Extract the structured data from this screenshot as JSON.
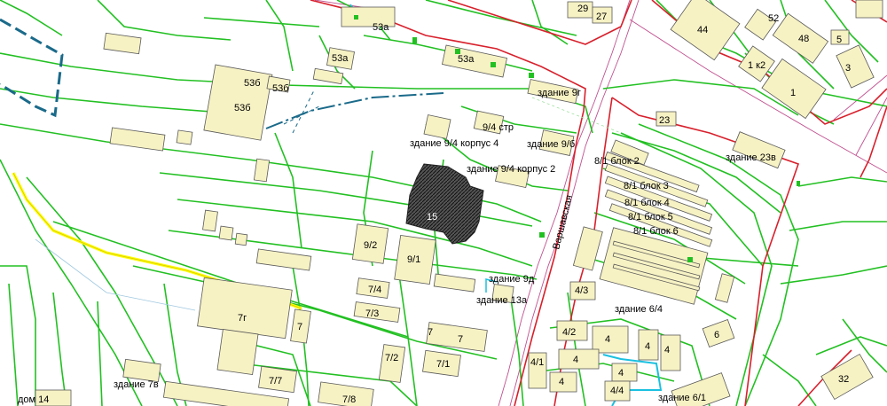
{
  "colors": {
    "parcel": "#22c022",
    "red_line": "#d8202c",
    "road_axis": "#c0508f",
    "building_fill": "#f7f2c4",
    "highlight": "#ffff00",
    "water": "#1a6a8a",
    "target": "#333333"
  },
  "street_label": "Варшавская",
  "labels": {
    "b53a_top": "53а",
    "b29": "29",
    "b27": "27",
    "b44": "44",
    "b52": "52",
    "b48": "48",
    "b5": "5",
    "b1k2": "1 к2",
    "b3": "3",
    "b1": "1",
    "b53b_a": "53б",
    "b53b_b": "53б",
    "b53b_c": "53б",
    "b53a_c": "53а",
    "b53a_d": "53а",
    "zd9g": "здание 9г",
    "b94str": "9/4 стр",
    "zd94k4": "здание 9/4 корпус 4",
    "zd9b": "здание 9/б",
    "zd94k2": "здание 9/4 корпус 2",
    "b23": "23",
    "b81b2": "8/1 блок 2",
    "zd23v": "здание 23в",
    "b81b3": "8/1 блок 3",
    "b81b4": "8/1 блок 4",
    "b81b5": "8/1 блок 5",
    "b81b6": "8/1 блок 6",
    "target": "15",
    "b92": "9/2",
    "b91": "9/1",
    "zd9d": "здание 9д",
    "zd13a": "здание 13а",
    "b74": "7/4",
    "b73": "7/3",
    "b7g": "7г",
    "b7a": "7",
    "b7b": "7",
    "b7c": "7",
    "b72": "7/2",
    "b71": "7/1",
    "b77": "7/7",
    "b78": "7/8",
    "zd7v": "здание 7в",
    "dom14": "дом 14",
    "b43": "4/3",
    "zd64": "здание 6/4",
    "b42": "4/2",
    "b4a": "4",
    "b4b": "4",
    "b4c": "4",
    "b4d": "4",
    "b4e": "4",
    "b4f": "4",
    "b41": "4/1",
    "b44s": "4/4",
    "zd61": "здание 6/1",
    "b6": "6",
    "b32": "32"
  }
}
